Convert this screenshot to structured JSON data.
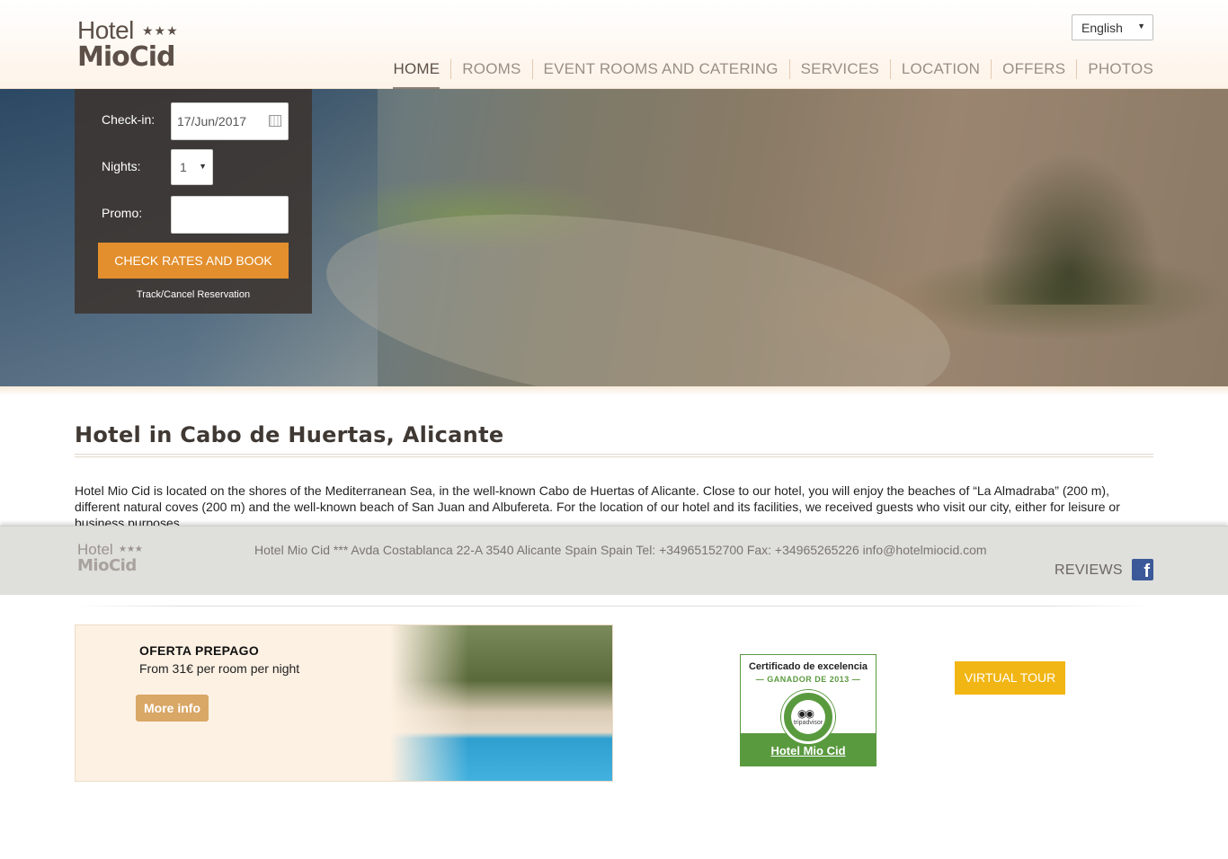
{
  "header": {
    "logo_top": "Hotel",
    "logo_stars": "★★★",
    "logo_bottom": "MioCid",
    "language": "English",
    "nav": [
      {
        "label": "HOME"
      },
      {
        "label": "ROOMS"
      },
      {
        "label": "EVENT ROOMS AND CATERING"
      },
      {
        "label": "SERVICES"
      },
      {
        "label": "LOCATION"
      },
      {
        "label": "OFFERS"
      },
      {
        "label": "PHOTOS"
      }
    ]
  },
  "booking": {
    "checkin_label": "Check-in:",
    "checkin_value": "17/Jun/2017",
    "nights_label": "Nights:",
    "nights_value": "1",
    "promo_label": "Promo:",
    "promo_value": "",
    "book_button": "CHECK RATES AND BOOK",
    "track_link": "Track/Cancel Reservation"
  },
  "main": {
    "title": "Hotel in Cabo de Huertas, Alicante",
    "intro": "Hotel Mio Cid is located on the shores of the Mediterranean Sea, in the well-known Cabo de Huertas of Alicante. Close to our hotel, you will enjoy the beaches of “La Almadraba” (200 m), different natural coves (200 m) and the well-known beach of San Juan and Albufereta. For the location of our hotel and its facilities, we received guests who visit our city, either for leisure or business purposes."
  },
  "footer": {
    "logo_top": "Hotel",
    "logo_stars": "★★★",
    "logo_bottom": "MioCid",
    "address": "Hotel Mio Cid *** Avda Costablanca 22-A 3540 Alicante Spain Spain Tel: +34965152700 Fax: +34965265226 info@hotelmiocid.com",
    "reviews": "REVIEWS",
    "facebook_glyph": "f"
  },
  "offer": {
    "title": "OFERTA PREPAGO",
    "subtitle": "From 31€ per room per night",
    "button": "More info"
  },
  "tripadvisor": {
    "line1": "Certificado de excelencia",
    "line2": "— GANADOR DE 2013 —",
    "brand": "tripadvisor",
    "eyes": "◉◉",
    "name": "Hotel Mio Cid"
  },
  "virtual_tour": "VIRTUAL TOUR",
  "colors": {
    "accent_orange": "#e38f2d",
    "tour_yellow": "#f1b614",
    "tripadvisor_green": "#5a9a3f",
    "brand_brown": "#5c5048"
  },
  "icons": {
    "calendar": "calendar-icon",
    "select_caret": "chevron-down-icon",
    "facebook": "facebook-icon"
  }
}
